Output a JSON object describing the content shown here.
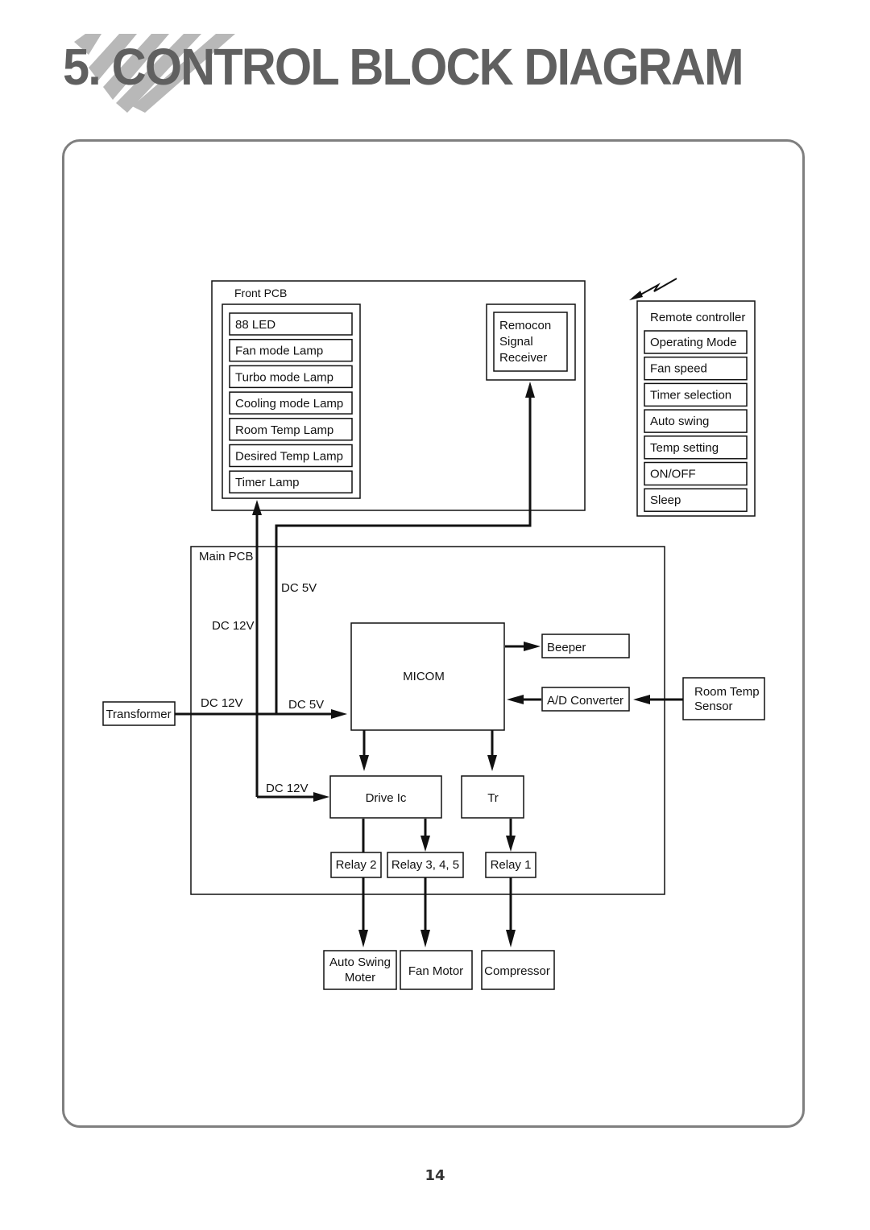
{
  "header": {
    "title": "5. CONTROL BLOCK DIAGRAM"
  },
  "page_number": "14",
  "colors": {
    "title": "#606060",
    "stripes": "#b8b8b8",
    "frame": "#7f7f7f",
    "line": "#111111"
  },
  "front_pcb": {
    "label": "Front PCB",
    "lamps": [
      "88 LED",
      "Fan mode Lamp",
      "Turbo mode Lamp",
      "Cooling mode Lamp",
      "Room Temp Lamp",
      "Desired Temp Lamp",
      "Timer Lamp"
    ],
    "remocon": [
      "Remocon",
      "Signal",
      "Receiver"
    ]
  },
  "remote_controller": {
    "label": "Remote controller",
    "items": [
      "Operating Mode",
      "Fan speed",
      "Timer selection",
      "Auto swing",
      "Temp setting",
      "ON/OFF",
      "Sleep"
    ],
    "signal_icon": "wireless-signal-icon"
  },
  "main_pcb": {
    "label": "Main PCB",
    "dc5v_top": "DC 5V",
    "dc12v_top": "DC 12V",
    "dc12v_in": "DC 12V",
    "dc5v_in": "DC 5V",
    "dc12v_drive": "DC 12V",
    "micom": "MICOM",
    "beeper": "Beeper",
    "ad_converter": "A/D Converter",
    "drive_ic": "Drive Ic",
    "tr": "Tr",
    "relay2": "Relay 2",
    "relay345": "Relay 3, 4, 5",
    "relay1": "Relay 1"
  },
  "external": {
    "transformer": "Transformer",
    "room_temp_sensor": [
      "Room Temp",
      "Sensor"
    ],
    "auto_swing_motor": [
      "Auto Swing",
      "Moter"
    ],
    "fan_motor": "Fan Motor",
    "compressor": "Compressor"
  }
}
